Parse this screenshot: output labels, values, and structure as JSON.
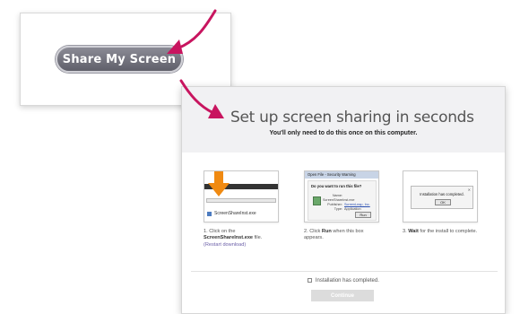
{
  "share_card": {
    "button_label": "Share My Screen"
  },
  "dialog": {
    "title": "Set up screen sharing in seconds",
    "subtitle": "You'll only need to do this once on this computer.",
    "steps": [
      {
        "prefix": "1. Click on the",
        "bold": "ScreenShareInst.exe",
        "suffix": "file.",
        "link": "(Restart download)",
        "thumb_file": "ScreenShareInst.exe"
      },
      {
        "prefix": "2. Click",
        "bold": "Run",
        "suffix": "when this box appears.",
        "thumb_title": "Open File - Security Warning",
        "thumb_question": "Do you want to run this file?",
        "thumb_rows": [
          {
            "k": "Name:",
            "v": "ScreenShareInst.exe"
          },
          {
            "k": "Publisher:",
            "v": "ScreenLeap, Inc."
          },
          {
            "k": "Type:",
            "v": "Application"
          }
        ],
        "thumb_button": "Run"
      },
      {
        "prefix": "3.",
        "bold": "Wait",
        "suffix": "for the install to complete.",
        "thumb_message": "Installation has completed.",
        "thumb_button": "OK"
      }
    ],
    "checkbox_label": "Installation has completed.",
    "continue_label": "Continue"
  },
  "colors": {
    "arrow_pink": "#c8155f",
    "download_arrow_orange": "#f08a12",
    "link": "#6b5fa8"
  }
}
